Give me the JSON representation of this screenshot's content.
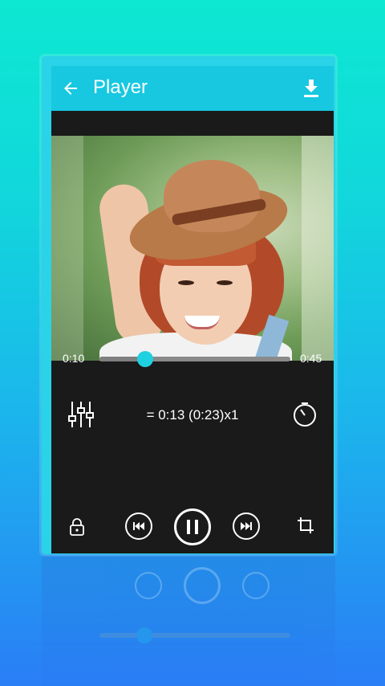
{
  "appbar": {
    "title": "Player"
  },
  "controls": {
    "speed_text": "= 0:13 (0:23)x1",
    "current_time": "0:10",
    "total_time": "0:45",
    "progress": 0.24
  },
  "icons": {
    "back": "arrow-left-icon",
    "download": "download-icon",
    "equalizer": "equalizer-icon",
    "timer": "timer-icon",
    "lock": "lock-icon",
    "previous": "skip-previous-icon",
    "pause": "pause-icon",
    "next": "skip-next-icon",
    "crop": "crop-icon"
  },
  "colors": {
    "accent": "#1fd0e0",
    "appbar": "#17c8e0",
    "player_bg": "#1a1a1a"
  }
}
